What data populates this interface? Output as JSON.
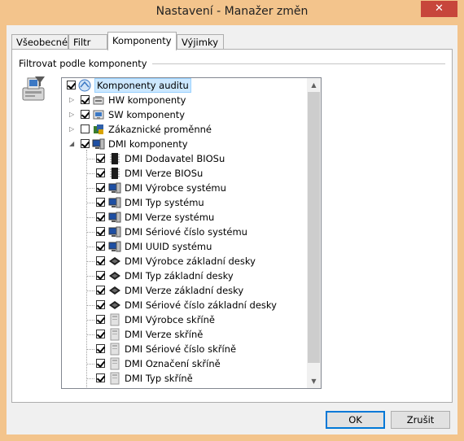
{
  "window": {
    "title": "Nastavení - Manažer změn",
    "close_glyph": "✕"
  },
  "tabs": [
    {
      "label": "Všeobecné",
      "active": false
    },
    {
      "label": "Filtr",
      "active": false
    },
    {
      "label": "Komponenty",
      "active": true
    },
    {
      "label": "Výjimky",
      "active": false
    }
  ],
  "group": {
    "label": "Filtrovat podle komponenty"
  },
  "tree": {
    "items": [
      {
        "label": "Komponenty auditu",
        "checked": true,
        "expander": "",
        "icon": "audit-components-icon",
        "selected": true,
        "level": 0
      },
      {
        "label": "HW komponenty",
        "checked": true,
        "expander": "▷",
        "icon": "hardware-icon",
        "selected": false,
        "level": 1
      },
      {
        "label": "SW komponenty",
        "checked": true,
        "expander": "▷",
        "icon": "software-icon",
        "selected": false,
        "level": 1
      },
      {
        "label": "Zákaznické proměnné",
        "checked": false,
        "expander": "▷",
        "icon": "custom-variables-icon",
        "selected": false,
        "level": 1
      },
      {
        "label": "DMI komponenty",
        "checked": true,
        "expander": "◢",
        "icon": "dmi-icon",
        "selected": false,
        "level": 1
      },
      {
        "label": "DMI Dodavatel BIOSu",
        "checked": true,
        "expander": "",
        "icon": "bios-chip-icon",
        "selected": false,
        "level": 2
      },
      {
        "label": "DMI Verze BIOSu",
        "checked": true,
        "expander": "",
        "icon": "bios-chip-icon",
        "selected": false,
        "level": 2
      },
      {
        "label": "DMI Výrobce systému",
        "checked": true,
        "expander": "",
        "icon": "monitor-icon",
        "selected": false,
        "level": 2
      },
      {
        "label": "DMI Typ systému",
        "checked": true,
        "expander": "",
        "icon": "monitor-icon",
        "selected": false,
        "level": 2
      },
      {
        "label": "DMI Verze systému",
        "checked": true,
        "expander": "",
        "icon": "monitor-icon",
        "selected": false,
        "level": 2
      },
      {
        "label": "DMI Sériové číslo systému",
        "checked": true,
        "expander": "",
        "icon": "monitor-icon",
        "selected": false,
        "level": 2
      },
      {
        "label": "DMI UUID systému",
        "checked": true,
        "expander": "",
        "icon": "monitor-icon",
        "selected": false,
        "level": 2
      },
      {
        "label": "DMI Výrobce základní desky",
        "checked": true,
        "expander": "",
        "icon": "motherboard-icon",
        "selected": false,
        "level": 2
      },
      {
        "label": "DMI Typ základní desky",
        "checked": true,
        "expander": "",
        "icon": "motherboard-icon",
        "selected": false,
        "level": 2
      },
      {
        "label": "DMI Verze základní desky",
        "checked": true,
        "expander": "",
        "icon": "motherboard-icon",
        "selected": false,
        "level": 2
      },
      {
        "label": "DMI Sériové číslo základní desky",
        "checked": true,
        "expander": "",
        "icon": "motherboard-icon",
        "selected": false,
        "level": 2
      },
      {
        "label": "DMI Výrobce skříně",
        "checked": true,
        "expander": "",
        "icon": "chassis-icon",
        "selected": false,
        "level": 2
      },
      {
        "label": "DMI Verze skříně",
        "checked": true,
        "expander": "",
        "icon": "chassis-icon",
        "selected": false,
        "level": 2
      },
      {
        "label": "DMI Sériové číslo skříně",
        "checked": true,
        "expander": "",
        "icon": "chassis-icon",
        "selected": false,
        "level": 2
      },
      {
        "label": "DMI Označení skříně",
        "checked": true,
        "expander": "",
        "icon": "chassis-icon",
        "selected": false,
        "level": 2
      },
      {
        "label": "DMI Typ skříně",
        "checked": true,
        "expander": "",
        "icon": "chassis-icon",
        "selected": false,
        "level": 2
      }
    ],
    "scroll_up_glyph": "▲",
    "scroll_down_glyph": "▼"
  },
  "buttons": {
    "ok": "OK",
    "cancel": "Zrušit"
  }
}
